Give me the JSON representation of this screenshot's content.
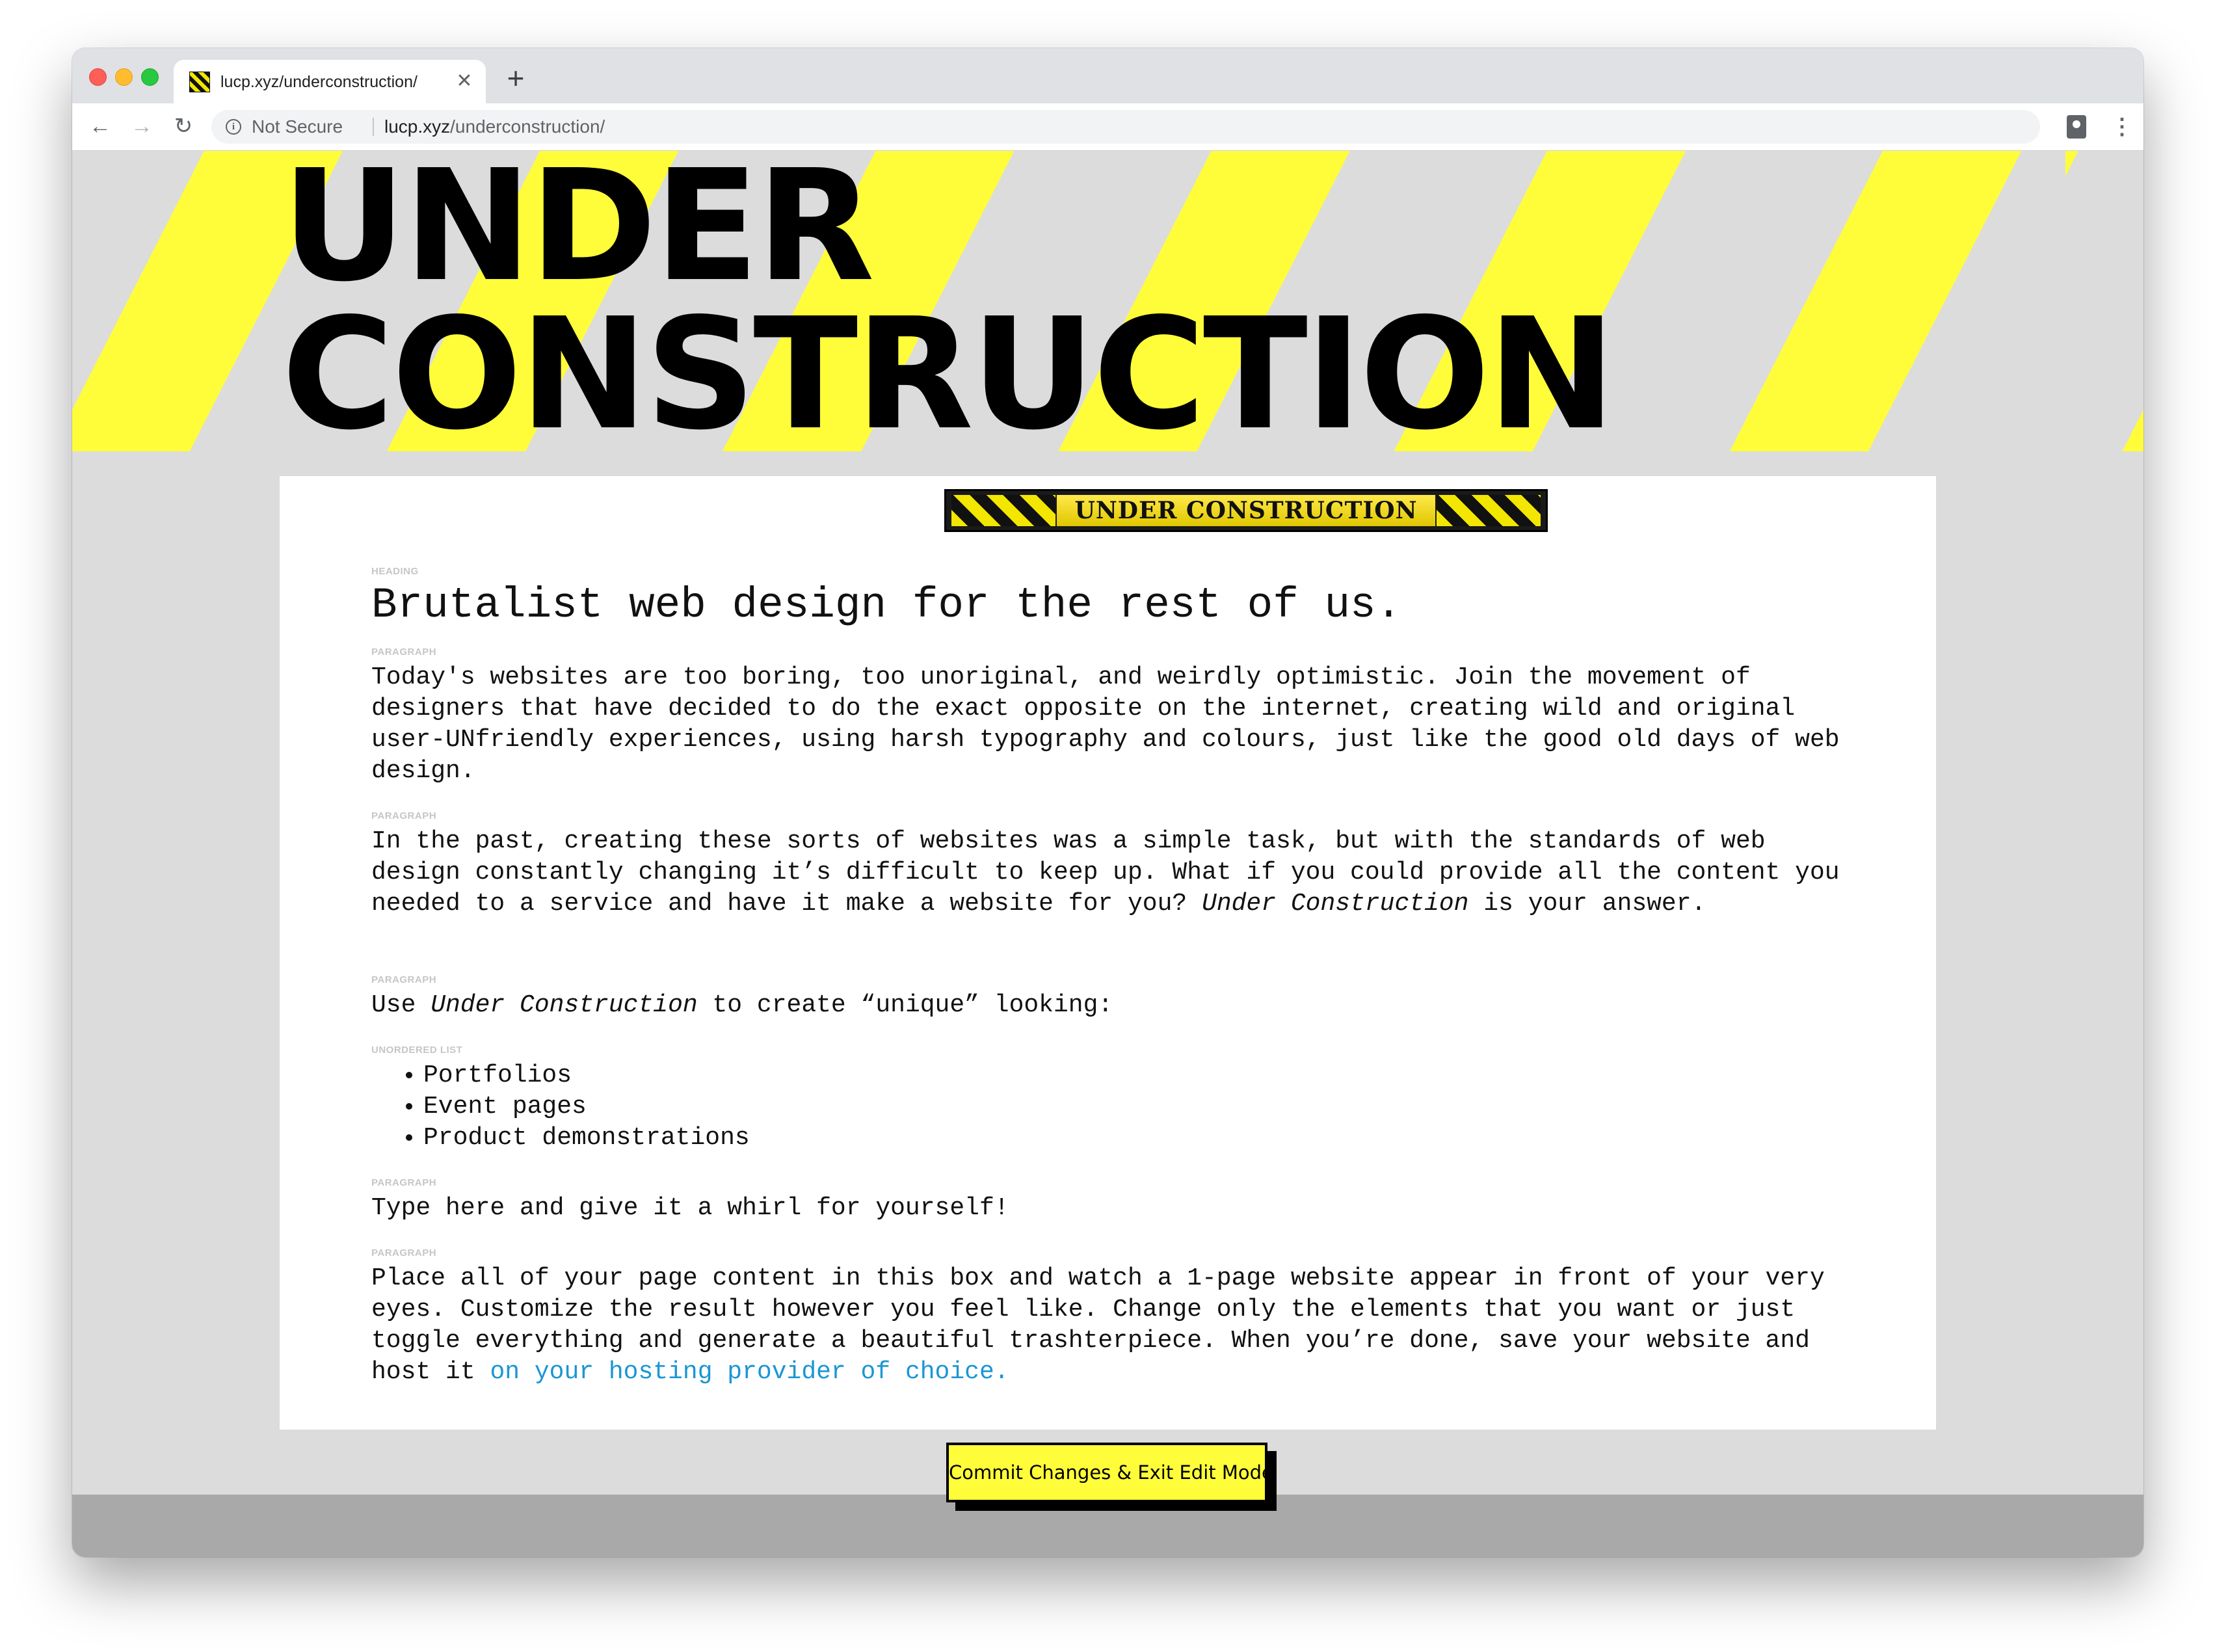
{
  "browser": {
    "tab": {
      "title": "lucp.xyz/underconstruction/",
      "close_glyph": "✕",
      "favicon": "hazard-stripes-favicon"
    },
    "new_tab_glyph": "+",
    "nav": {
      "back_glyph": "←",
      "forward_glyph": "→",
      "reload_glyph": "↻"
    },
    "address": {
      "security_label": "Not Secure",
      "url_host": "lucp.xyz",
      "url_path": "/underconstruction/",
      "info_glyph": "i"
    },
    "menu_glyph": "⋮"
  },
  "page": {
    "hero": {
      "line1": "UNDER",
      "line2": "CONSTRUCTION"
    },
    "banner_text": "UNDER CONSTRUCTION",
    "blocks": {
      "heading": {
        "label": "HEADING",
        "text": "Brutalist web design for the rest of us."
      },
      "p1": {
        "label": "PARAGRAPH",
        "text": "Today's websites are too boring, too unoriginal, and weirdly optimistic. Join the movement of designers that have decided to do the exact opposite on the internet, creating wild and original user-UNfriendly experiences, using harsh typography and colours, just like the good old days of web design."
      },
      "p2": {
        "label": "PARAGRAPH",
        "before": "In the past, creating these sorts of websites was a simple task, but with the standards of web design constantly changing it’s difficult to keep up. What if you could provide all the content you needed to a service and have it make a website for you? ",
        "emphasis": "Under Construction",
        "after": " is your answer."
      },
      "p3": {
        "label": "PARAGRAPH",
        "before": "Use ",
        "emphasis": "Under Construction",
        "after": " to create “unique” looking:"
      },
      "list": {
        "label": "UNORDERED LIST",
        "items": [
          "Portfolios",
          "Event pages",
          "Product demonstrations"
        ]
      },
      "p4": {
        "label": "PARAGRAPH",
        "text": "Type here and give it a whirl for yourself!"
      },
      "p5": {
        "label": "PARAGRAPH",
        "before": "Place all of your page content in this box and watch a 1-page website appear in front of your very eyes. Customize the result however you feel like. Change only the elements that you want or just toggle everything and generate a beautiful trashterpiece. When you’re done, save your website and host it ",
        "link_text": "on your hosting provider of choice."
      }
    },
    "commit_button": "Commit Changes & Exit Edit Mode"
  },
  "colors": {
    "accent_yellow": "#fffd3a",
    "stripe_gray": "#dcdcdc",
    "link_blue": "#1a96d4",
    "footer_gray": "#a9a9a9"
  }
}
